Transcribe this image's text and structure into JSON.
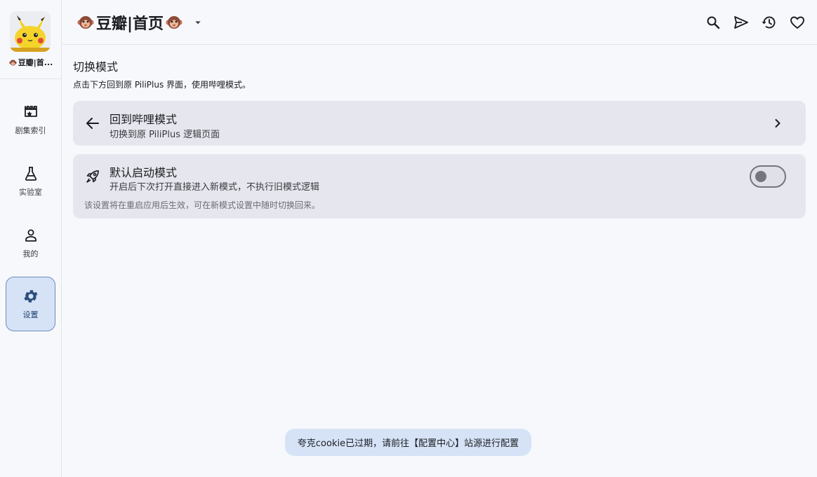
{
  "app": {
    "title": "豆瓣|首页",
    "source_label": "豆瓣|首..."
  },
  "colors": {
    "background": "#f7f8fc",
    "card": "#e6e7ee",
    "accent_container": "#d6e3f7",
    "accent_border": "#6b8db8"
  },
  "rail": {
    "items": [
      {
        "label": "剧集索引",
        "icon": "movie-edit-icon",
        "active": false
      },
      {
        "label": "实验室",
        "icon": "flask-icon",
        "active": false
      },
      {
        "label": "我的",
        "icon": "person-icon",
        "active": false
      },
      {
        "label": "设置",
        "icon": "gear-icon",
        "active": true
      }
    ]
  },
  "topbar": {
    "actions": [
      {
        "icon": "search-icon"
      },
      {
        "icon": "send-icon"
      },
      {
        "icon": "history-icon"
      },
      {
        "icon": "heart-icon"
      }
    ]
  },
  "main": {
    "section_title": "切换模式",
    "section_desc": "点击下方回到原 PiliPlus 界面，使用哔哩模式。",
    "back_card": {
      "title": "回到哔哩模式",
      "subtitle": "切换到原 PiliPlus 逻辑页面",
      "icon": "arrow-left-icon"
    },
    "default_card": {
      "title": "默认启动模式",
      "subtitle": "开启后下次打开直接进入新模式，不执行旧模式逻辑",
      "note": "该设置将在重启应用后生效，可在新模式设置中随时切换回来。",
      "icon": "rocket-icon",
      "toggle_on": false
    }
  },
  "toast": {
    "message": "夸克cookie已过期，请前往【配置中心】站源进行配置"
  }
}
